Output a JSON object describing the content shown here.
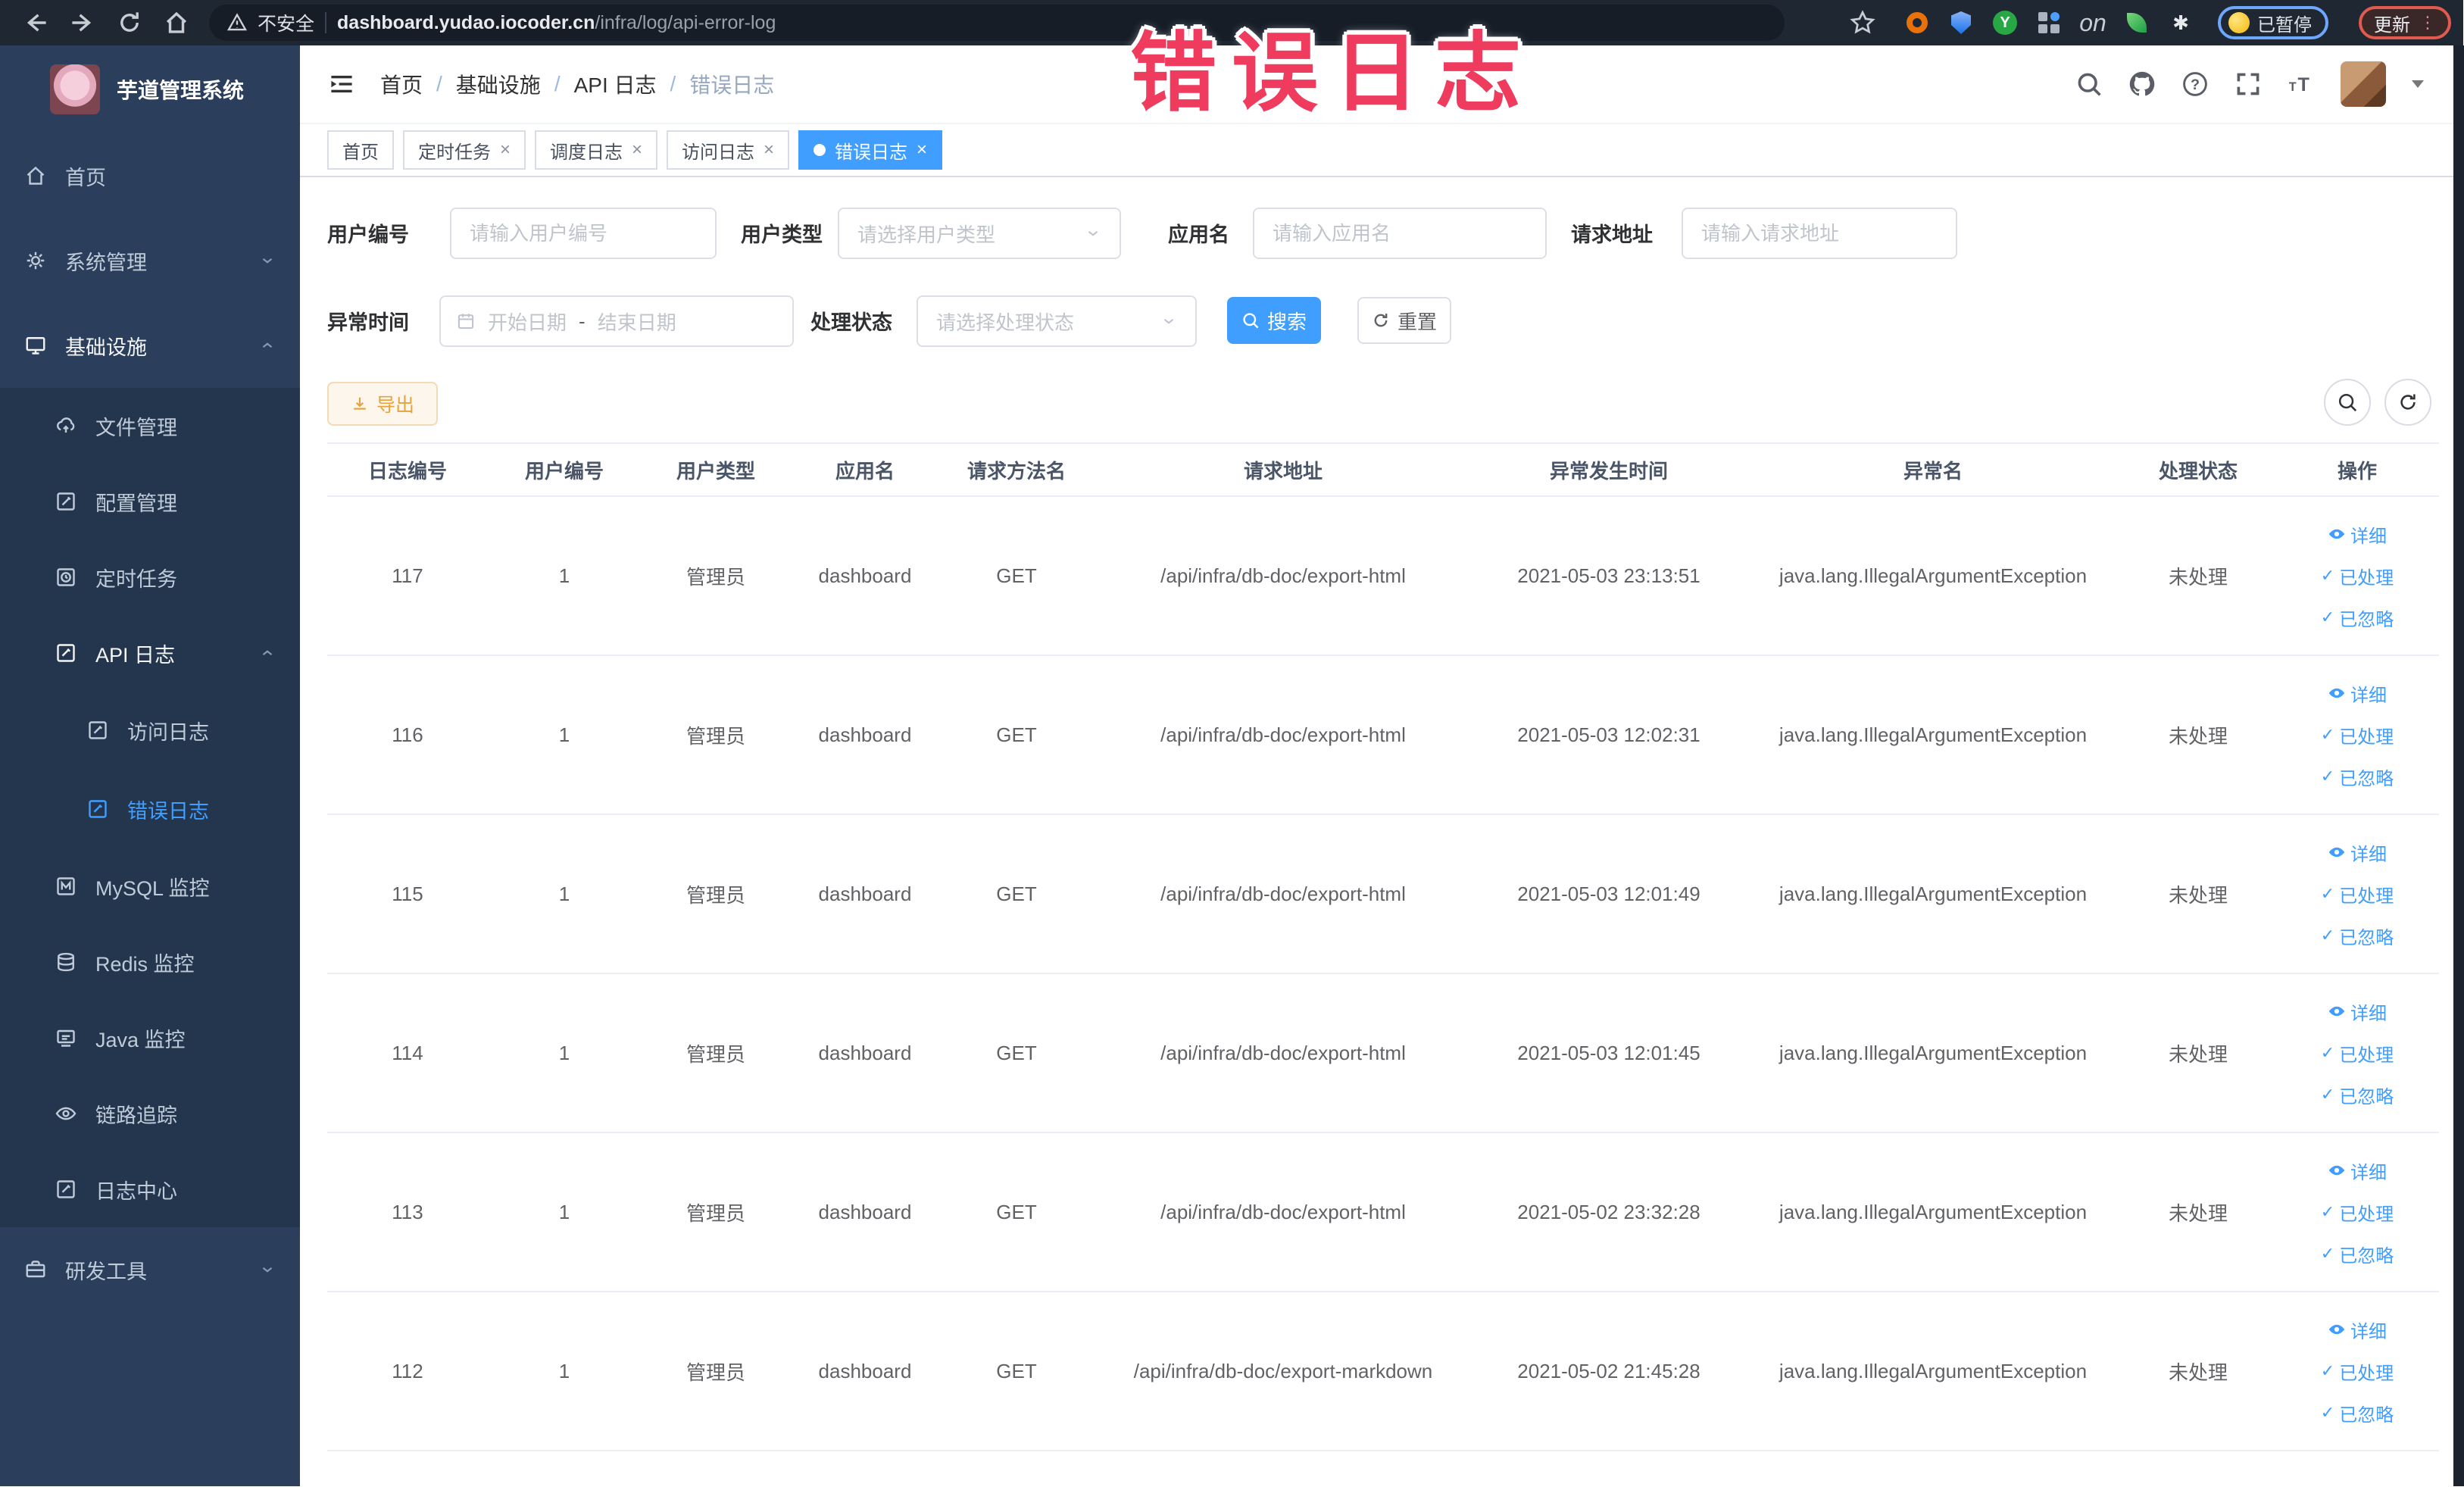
{
  "annotation": {
    "text": "错误日志",
    "color": "#ee3b5e"
  },
  "browser": {
    "security_label": "不安全",
    "url_host": "dashboard.yudao.iocoder.cn",
    "url_path": "/infra/log/api-error-log",
    "paused_label": "已暂停",
    "update_label": "更新"
  },
  "sidebar": {
    "title": "芋道管理系统",
    "items": [
      {
        "label": "首页"
      },
      {
        "label": "系统管理"
      },
      {
        "label": "基础设施"
      },
      {
        "label": "文件管理"
      },
      {
        "label": "配置管理"
      },
      {
        "label": "定时任务"
      },
      {
        "label": "API 日志"
      },
      {
        "label": "访问日志"
      },
      {
        "label": "错误日志"
      },
      {
        "label": "MySQL 监控"
      },
      {
        "label": "Redis 监控"
      },
      {
        "label": "Java 监控"
      },
      {
        "label": "链路追踪"
      },
      {
        "label": "日志中心"
      },
      {
        "label": "研发工具"
      }
    ]
  },
  "header": {
    "breadcrumbs": [
      "首页",
      "基础设施",
      "API 日志",
      "错误日志"
    ]
  },
  "tabs": [
    {
      "label": "首页"
    },
    {
      "label": "定时任务"
    },
    {
      "label": "调度日志"
    },
    {
      "label": "访问日志"
    },
    {
      "label": "错误日志"
    }
  ],
  "filters": {
    "user_no": {
      "label": "用户编号",
      "placeholder": "请输入用户编号"
    },
    "user_type": {
      "label": "用户类型",
      "placeholder": "请选择用户类型"
    },
    "app_name": {
      "label": "应用名",
      "placeholder": "请输入应用名"
    },
    "request_url": {
      "label": "请求地址",
      "placeholder": "请输入请求地址"
    },
    "error_time": {
      "label": "异常时间",
      "start_placeholder": "开始日期",
      "separator": "-",
      "end_placeholder": "结束日期"
    },
    "process_status": {
      "label": "处理状态",
      "placeholder": "请选择处理状态"
    },
    "search_label": "搜索",
    "reset_label": "重置"
  },
  "toolbar": {
    "export_label": "导出"
  },
  "table": {
    "columns": [
      "日志编号",
      "用户编号",
      "用户类型",
      "应用名",
      "请求方法名",
      "请求地址",
      "异常发生时间",
      "异常名",
      "处理状态",
      "操作"
    ],
    "actions": [
      "详细",
      "已处理",
      "已忽略"
    ],
    "rows": [
      {
        "log_id": "117",
        "user_id": "1",
        "user_type": "管理员",
        "app_name": "dashboard",
        "method": "GET",
        "url": "/api/infra/db-doc/export-html",
        "time": "2021-05-03 23:13:51",
        "exception": "java.lang.IllegalArgumentException",
        "status": "未处理"
      },
      {
        "log_id": "116",
        "user_id": "1",
        "user_type": "管理员",
        "app_name": "dashboard",
        "method": "GET",
        "url": "/api/infra/db-doc/export-html",
        "time": "2021-05-03 12:02:31",
        "exception": "java.lang.IllegalArgumentException",
        "status": "未处理"
      },
      {
        "log_id": "115",
        "user_id": "1",
        "user_type": "管理员",
        "app_name": "dashboard",
        "method": "GET",
        "url": "/api/infra/db-doc/export-html",
        "time": "2021-05-03 12:01:49",
        "exception": "java.lang.IllegalArgumentException",
        "status": "未处理"
      },
      {
        "log_id": "114",
        "user_id": "1",
        "user_type": "管理员",
        "app_name": "dashboard",
        "method": "GET",
        "url": "/api/infra/db-doc/export-html",
        "time": "2021-05-03 12:01:45",
        "exception": "java.lang.IllegalArgumentException",
        "status": "未处理"
      },
      {
        "log_id": "113",
        "user_id": "1",
        "user_type": "管理员",
        "app_name": "dashboard",
        "method": "GET",
        "url": "/api/infra/db-doc/export-html",
        "time": "2021-05-02 23:32:28",
        "exception": "java.lang.IllegalArgumentException",
        "status": "未处理"
      },
      {
        "log_id": "112",
        "user_id": "1",
        "user_type": "管理员",
        "app_name": "dashboard",
        "method": "GET",
        "url": "/api/infra/db-doc/export-markdown",
        "time": "2021-05-02 21:45:28",
        "exception": "java.lang.IllegalArgumentException",
        "status": "未处理"
      }
    ]
  }
}
